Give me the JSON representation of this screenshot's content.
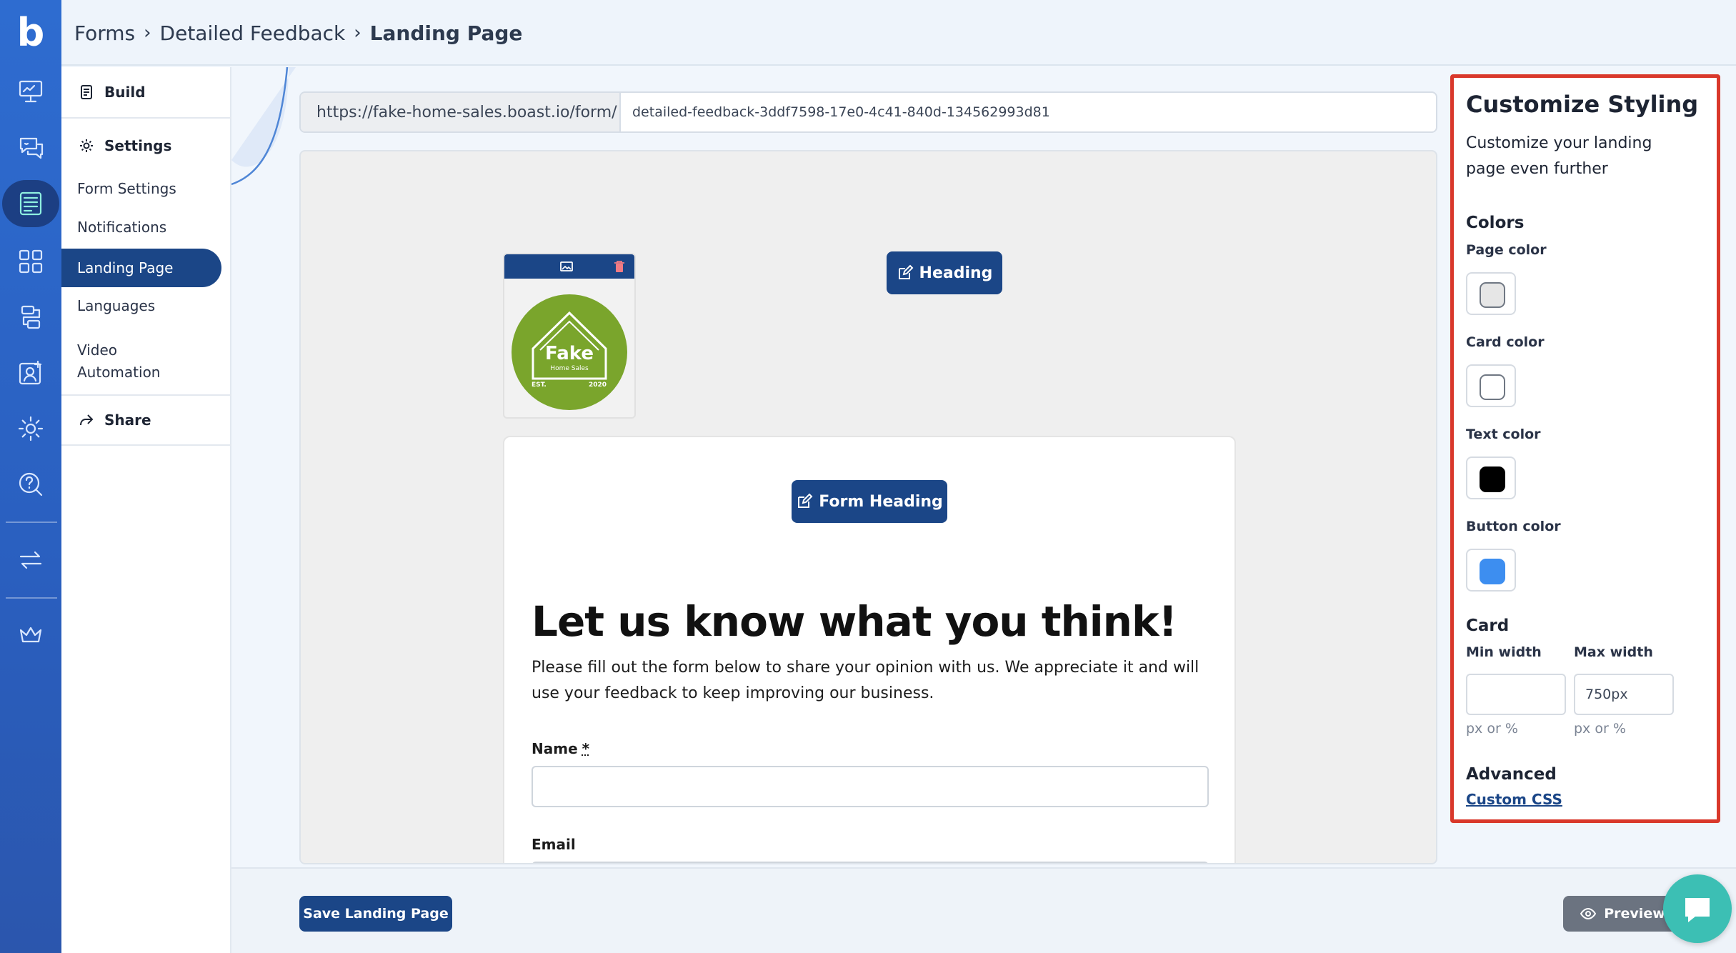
{
  "app": {
    "logo_letter": "b"
  },
  "breadcrumb": {
    "items": [
      "Forms",
      "Detailed Feedback"
    ],
    "current": "Landing Page",
    "separator": "›"
  },
  "subnav": {
    "build": "Build",
    "settings": "Settings",
    "items": [
      "Form Settings",
      "Notifications",
      "Landing Page",
      "Languages",
      "Video",
      "Automation"
    ],
    "share": "Share"
  },
  "url": {
    "prefix": "https://fake-home-sales.boast.io/form/",
    "slug": "detailed-feedback-3ddf7598-17e0-4c41-840d-134562993d81"
  },
  "preview": {
    "heading_button": "Heading",
    "form_heading_button": "Form Heading",
    "logo": {
      "text": "Fake",
      "sub": "Home Sales",
      "est": "EST.",
      "year": "2020"
    },
    "form": {
      "title": "Let us know what you think!",
      "description": "Please fill out the form below to share your opinion with us. We appreciate it and will use your feedback to keep improving our business.",
      "name_label": "Name",
      "required_mark": "*",
      "email_label": "Email"
    }
  },
  "footer": {
    "save_label": "Save Landing Page",
    "preview_label": "Preview"
  },
  "styling": {
    "title": "Customize Styling",
    "subtitle": "Customize your landing page even further",
    "colors_heading": "Colors",
    "page_color": "Page color",
    "card_color": "Card color",
    "text_color": "Text color",
    "button_color": "Button color",
    "card_heading": "Card",
    "min_width_label": "Min width",
    "max_width_label": "Max width",
    "min_width_value": "",
    "max_width_value": "750px",
    "hint": "px or %",
    "advanced_heading": "Advanced",
    "custom_css": "Custom CSS"
  },
  "colors": {
    "accent": "#1b4687",
    "rail": "#2e6cd0",
    "highlight": "#d9382b",
    "page_swatch": "#e6e6e6",
    "card_swatch": "#ffffff",
    "text_swatch": "#000000",
    "button_swatch": "#3d8ef0",
    "logo_green": "#7aa52c"
  },
  "icons": [
    "dashboard-icon",
    "reviews-icon",
    "forms-icon",
    "widgets-icon",
    "integrations-icon",
    "contacts-icon",
    "settings-icon",
    "help-icon",
    "switch-icon",
    "crown-icon"
  ]
}
